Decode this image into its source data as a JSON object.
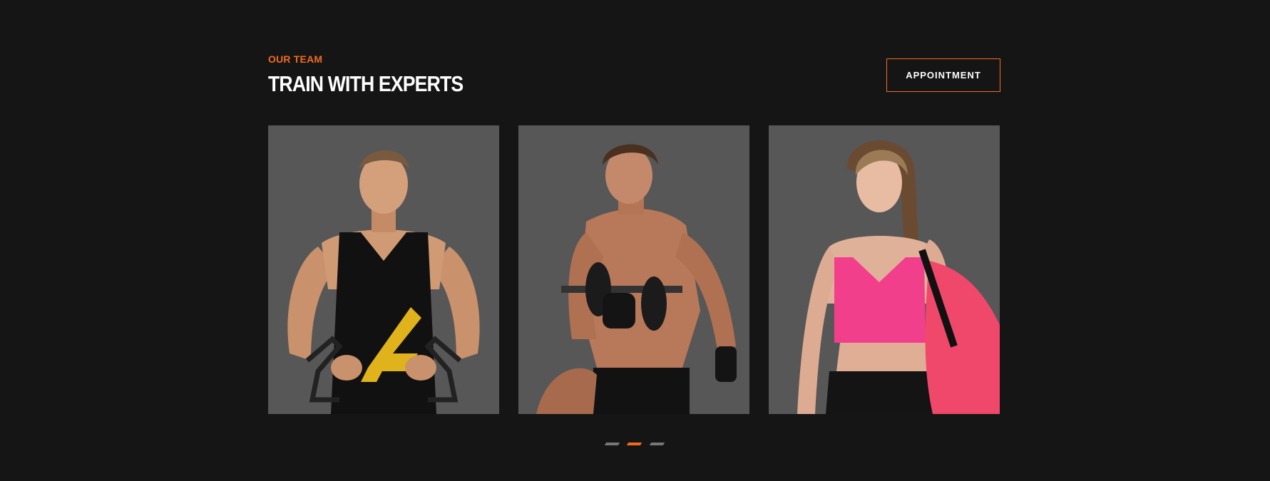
{
  "header": {
    "eyebrow": "OUR TEAM",
    "title": "TRAIN WITH EXPERTS",
    "appointment_label": "APPOINTMENT"
  },
  "colors": {
    "background": "#151515",
    "accent": "#f26b1d",
    "card_background": "#575757"
  },
  "team": [
    {
      "image": "trainer-with-resistance-bands-photo"
    },
    {
      "image": "trainer-with-dumbbell-photo"
    },
    {
      "image": "trainer-with-gym-bag-photo"
    }
  ],
  "carousel": {
    "count": 3,
    "active_index": 1
  }
}
